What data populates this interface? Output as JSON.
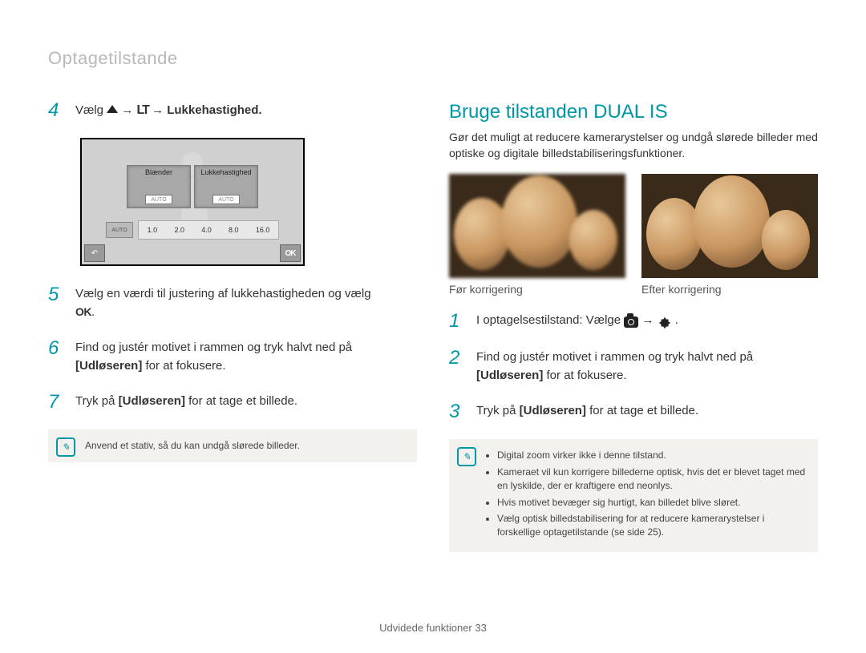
{
  "breadcrumb": "Optagetilstande",
  "left": {
    "step4": {
      "num": "4",
      "pre": "Vælg ",
      "lt": "LT",
      "post": " → Lukkehastighed."
    },
    "camera_ui": {
      "aperture_label": "Blænder",
      "shutter_label": "Lukkehastighed",
      "auto_label": "AUTO",
      "ticks": [
        "1.0",
        "2.0",
        "4.0",
        "8.0",
        "16.0"
      ],
      "ok_label": "OK",
      "back_glyph": "↶"
    },
    "step5": {
      "num": "5",
      "text_pre": "Vælg en værdi til justering af lukkehastigheden og vælg ",
      "ok_inline": "OK",
      "period": "."
    },
    "step6": {
      "num": "6",
      "line1": "Find og justér motivet i rammen og tryk halvt ned på ",
      "shutter_word": "[Udløseren]",
      "line2": " for at fokusere."
    },
    "step7": {
      "num": "7",
      "pre": "Tryk på ",
      "shutter_word": "[Udløseren]",
      "post": " for at tage et billede."
    },
    "note": {
      "icon": "✎",
      "text": "Anvend et stativ, så du kan undgå slørede billeder."
    }
  },
  "right": {
    "section_title": "Bruge tilstanden DUAL IS",
    "section_desc": "Gør det muligt at reducere kamerarystelser og undgå slørede billeder med optiske og digitale billedstabiliseringsfunktioner.",
    "caption_before": "Før korrigering",
    "caption_after": "Efter korrigering",
    "step1": {
      "num": "1",
      "text": "I optagelsestilstand: Vælge "
    },
    "step2": {
      "num": "2",
      "line1": "Find og justér motivet i rammen og tryk halvt ned på ",
      "shutter_word": "[Udløseren]",
      "line2": " for at fokusere."
    },
    "step3": {
      "num": "3",
      "pre": "Tryk på ",
      "shutter_word": "[Udløseren]",
      "post": " for at tage et billede."
    },
    "note": {
      "icon": "✎",
      "items": [
        "Digital zoom virker ikke i denne tilstand.",
        "Kameraet vil kun korrigere billederne optisk, hvis det er blevet taget med en lyskilde, der er kraftigere end neonlys.",
        "Hvis motivet bevæger sig hurtigt, kan billedet blive sløret.",
        "Vælg optisk billedstabilisering for at reducere kamerarystelser i forskellige optagetilstande (se side 25)."
      ]
    }
  },
  "footer": {
    "label": "Udvidede funktioner",
    "page": "33"
  }
}
